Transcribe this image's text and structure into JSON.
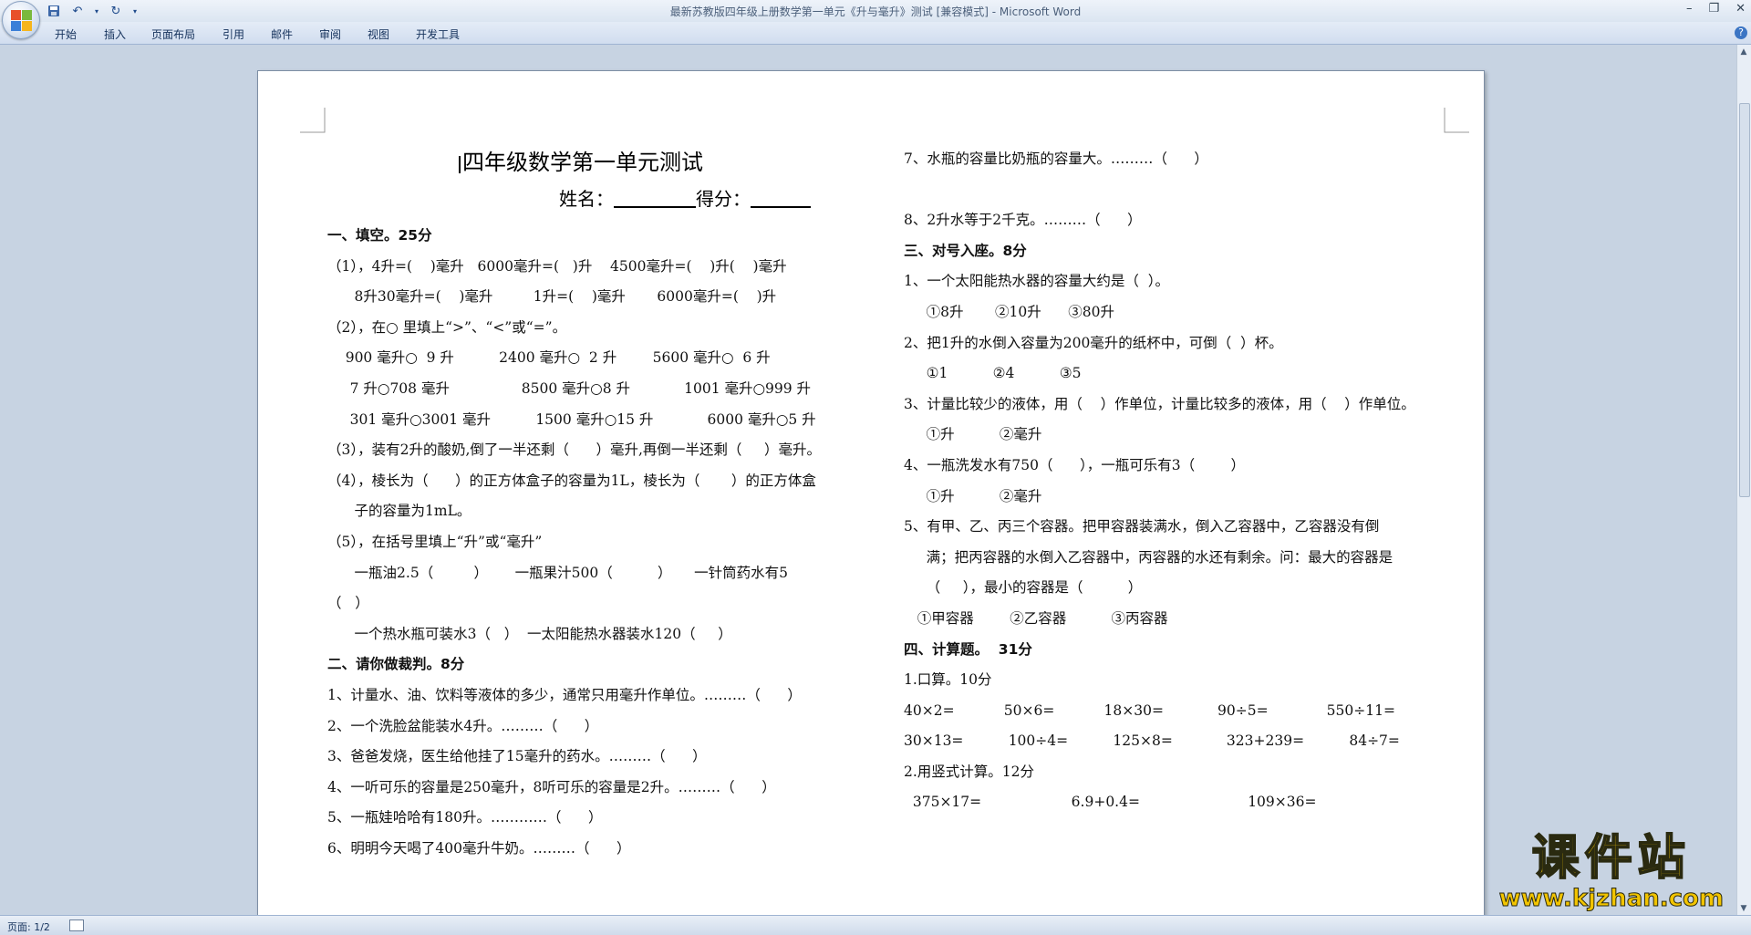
{
  "window": {
    "title": "最新苏教版四年级上册数学第一单元《升与毫升》测试 [兼容模式] - Microsoft Word",
    "controls": [
      "–",
      "❐",
      "✕"
    ]
  },
  "ribbon": {
    "tabs": [
      "开始",
      "插入",
      "页面布局",
      "引用",
      "邮件",
      "审阅",
      "视图",
      "开发工具"
    ],
    "help": "?"
  },
  "status": {
    "page": "页面: 1/2"
  },
  "watermark": {
    "text": "课件站",
    "url": "www.kjzhan.com"
  },
  "colors": {
    "titlebar": "#dbe5f1",
    "workspace": "#c7d3e2",
    "watermark": "#f2c400"
  },
  "doc": {
    "title": "四年级数学第一单元测试",
    "name_label": "姓名：",
    "score_label": "得分：",
    "left": [
      "一、填空。25分",
      "（1），4升=(    )毫升   6000毫升=(   )升    4500毫升=(    )升(    )毫升",
      "      8升30毫升=(    )毫升         1升=(    )毫升       6000毫升=(    )升",
      "（2），在○ 里填上“>”、“<”或“=”。",
      "    900 毫升○  9 升          2400 毫升○  2 升        5600 毫升○  6 升",
      "     7 升○708 毫升                8500 毫升○8 升            1001 毫升○999 升",
      "     301 毫升○3001 毫升          1500 毫升○15 升            6000 毫升○5 升",
      "（3），装有2升的酸奶,倒了一半还剩（      ）毫升,再倒一半还剩（     ）毫升。",
      "（4），棱长为（      ）的正方体盒子的容量为1L，棱长为（       ）的正方体盒",
      "      子的容量为1mL。",
      "（5），在括号里填上“升”或“毫升”",
      "      一瓶油2.5（         ）      一瓶果汁500（          ）     一针筒药水有5",
      "（   ）",
      "      一个热水瓶可装水3（   ）  一太阳能热水器装水120（     ）",
      "二、请你做裁判。8分",
      "1、计量水、油、饮料等液体的多少，通常只用毫升作单位。………（      ）",
      "2、一个洗脸盆能装水4升。………（      ）",
      "3、爸爸发烧，医生给他挂了15毫升的药水。………（      ）",
      "4、一听可乐的容量是250毫升，8听可乐的容量是2升。………（      ）",
      "5、一瓶娃哈哈有180升。…………（      ）",
      "6、明明今天喝了400毫升牛奶。………（      ）"
    ],
    "right": [
      "7、水瓶的容量比奶瓶的容量大。………（      ）",
      "",
      "8、2升水等于2千克。………（      ）",
      "三、对号入座。8分",
      "1、一个太阳能热水器的容量大约是（  ）。",
      "     ①8升       ②10升      ③80升",
      "2、把1升的水倒入容量为200毫升的纸杯中，可倒（  ）杯。",
      "     ①1          ②4          ③5",
      "3、计量比较少的液体，用（    ）作单位，计量比较多的液体，用（    ）作单位。",
      "     ①升          ②毫升",
      "4、一瓶洗发水有750（      ），一瓶可乐有3（        ）",
      "     ①升          ②毫升",
      "5、有甲、乙、丙三个容器。把甲容器装满水，倒入乙容器中，乙容器没有倒",
      "     满；把丙容器的水倒入乙容器中，丙容器的水还有剩余。问：最大的容器是",
      "     （     ），最小的容器是（          ）",
      "   ①甲容器        ②乙容器          ③丙容器",
      "四、计算题。  31分",
      "1.口算。10分",
      "40×2=           50×6=           18×30=            90÷5=             550÷11=",
      "30×13=          100÷4=          125×8=            323+239=          84÷7=",
      "2.用竖式计算。12分",
      "  375×17=                    6.9+0.4=                        109×36=",
      "",
      ""
    ]
  }
}
